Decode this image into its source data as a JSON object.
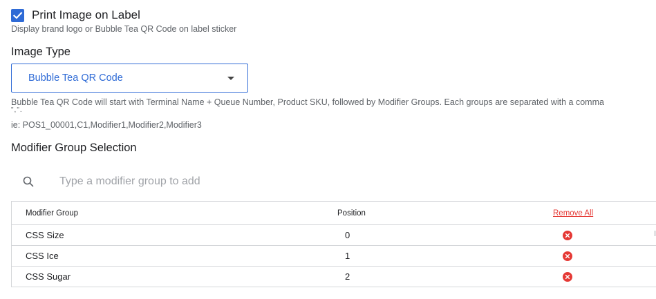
{
  "print_image": {
    "checked": true,
    "label": "Print Image on Label",
    "description": "Display brand logo or Bubble Tea QR Code on label sticker"
  },
  "image_type": {
    "title": "Image Type",
    "selected": "Bubble Tea QR Code",
    "info_line1": "Bubble Tea QR Code will start with Terminal Name + Queue Number, Product SKU, followed by Modifier Groups. Each groups are separated with a comma",
    "info_line2": "\",\".",
    "info_line3": "ie: POS1_00001,C1,Modifier1,Modifier2,Modifier3"
  },
  "modifier_selection": {
    "title": "Modifier Group Selection",
    "search_placeholder": "Type a modifier group to add",
    "search_value": ""
  },
  "table": {
    "headers": {
      "group": "Modifier Group",
      "position": "Position",
      "remove_all": "Remove All"
    },
    "rows": [
      {
        "group": "CSS Size",
        "position": "0"
      },
      {
        "group": "CSS Ice",
        "position": "1"
      },
      {
        "group": "CSS Sugar",
        "position": "2"
      }
    ]
  },
  "colors": {
    "accent": "#2f6bd6",
    "danger": "#e53935",
    "muted_text": "#5f6368"
  },
  "icons": {
    "checkbox": "check-icon",
    "dropdown": "caret-down-icon",
    "search": "search-icon",
    "remove": "remove-circle-icon"
  }
}
